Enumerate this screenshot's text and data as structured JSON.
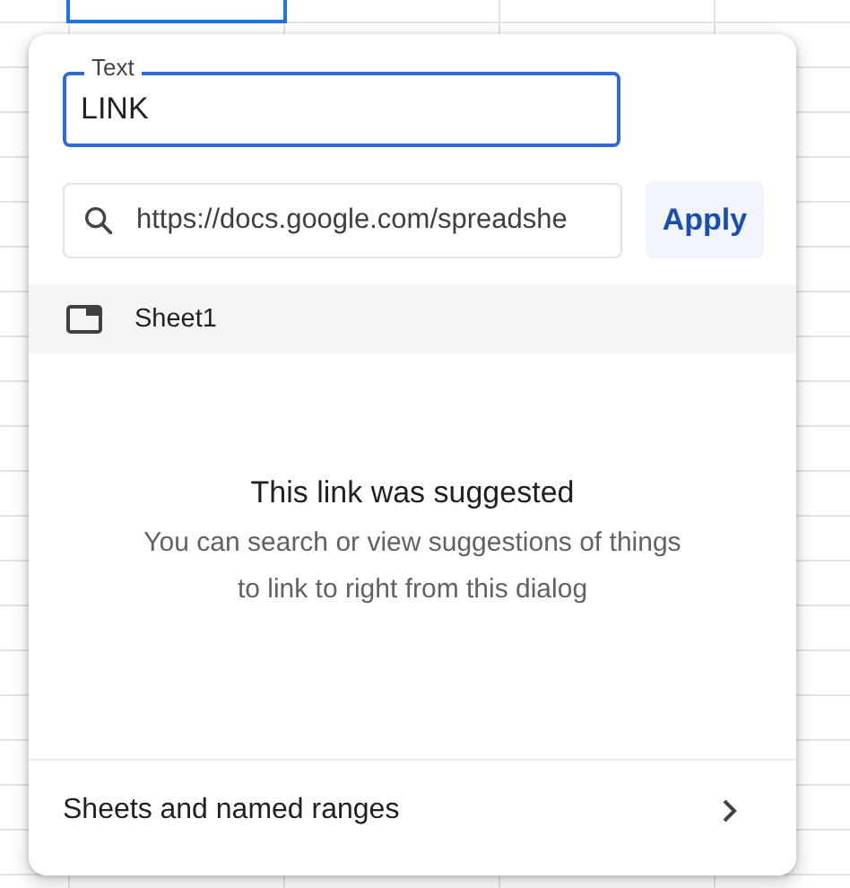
{
  "text_field": {
    "label": "Text",
    "value": "LINK",
    "focused": true
  },
  "link_field": {
    "value": "https://docs.google.com/spreadshe",
    "focused": false
  },
  "apply_button": {
    "label": "Apply"
  },
  "results": [
    {
      "label": "Sheet1",
      "selected": true
    }
  ],
  "empty_state": {
    "title": "This link was suggested",
    "description": "You can search or view suggestions of things to link to right from this dialog"
  },
  "footer": {
    "label": "Sheets and named ranges"
  }
}
